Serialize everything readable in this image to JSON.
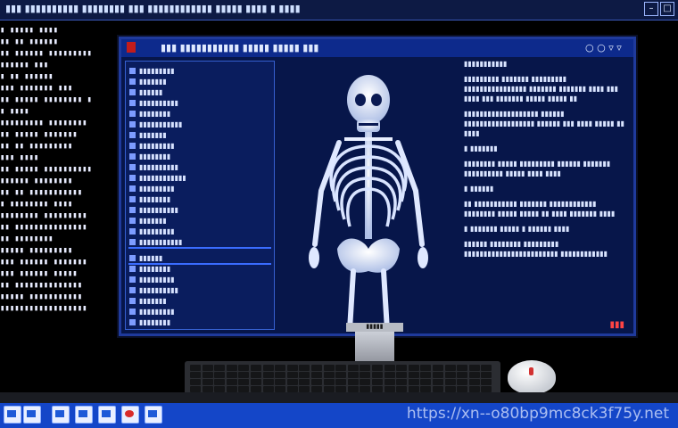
{
  "watermark": "https://xn--o80bp9mc8ck3f75y.net"
}
